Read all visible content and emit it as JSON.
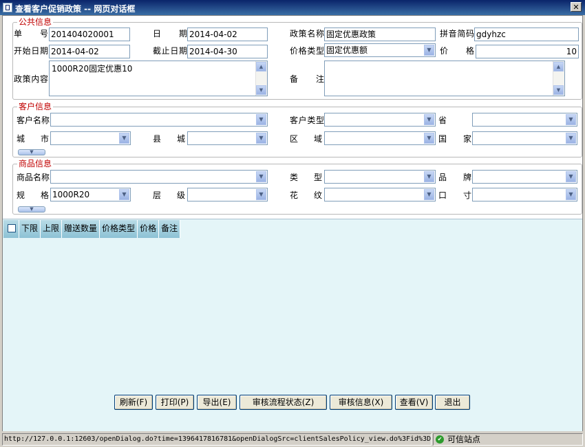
{
  "window": {
    "title": "查看客户促销政策 -- 网页对话框",
    "close": "✕"
  },
  "public": {
    "legend": "公共信息",
    "order_no": {
      "label": "单号",
      "value": "201404020001"
    },
    "date": {
      "label": "日期",
      "value": "2014-04-02"
    },
    "policy_name": {
      "label": "政策名称",
      "value": "固定优惠政策"
    },
    "pinyin": {
      "label": "拼音简码",
      "value": "gdyhzc"
    },
    "start_date": {
      "label": "开始日期",
      "value": "2014-04-02"
    },
    "end_date": {
      "label": "截止日期",
      "value": "2014-04-30"
    },
    "price_type": {
      "label": "价格类型",
      "value": "固定优惠额"
    },
    "price": {
      "label": "价格",
      "value": "10"
    },
    "content": {
      "label": "政策内容",
      "value": "1000R20固定优惠10"
    },
    "remark": {
      "label": "备注",
      "value": ""
    }
  },
  "customer": {
    "legend": "客户信息",
    "name": {
      "label": "客户名称"
    },
    "type": {
      "label": "客户类型"
    },
    "province": {
      "label": "省"
    },
    "city": {
      "label": "城市"
    },
    "county": {
      "label": "县城"
    },
    "district": {
      "label": "区域"
    },
    "country": {
      "label": "国家"
    }
  },
  "product": {
    "legend": "商品信息",
    "name": {
      "label": "商品名称"
    },
    "category": {
      "label": "类型"
    },
    "brand": {
      "label": "品牌"
    },
    "spec": {
      "label": "规格",
      "value": "1000R20"
    },
    "level": {
      "label": "层级"
    },
    "pattern": {
      "label": "花纹"
    },
    "caliber": {
      "label": "口寸"
    }
  },
  "grid": {
    "columns": [
      "下限",
      "上限",
      "赠送数量",
      "价格类型",
      "价格",
      "备注"
    ]
  },
  "buttons": {
    "refresh": "刷新(F)",
    "print": "打印(P)",
    "export": "导出(E)",
    "flow_status": "审核流程状态(Z)",
    "audit_info": "审核信息(X)",
    "view": "查看(V)",
    "exit": "退出"
  },
  "status": {
    "url": "http://127.0.0.1:12603/openDialog.do?time=1396417816781&openDialogSrc=clientSalesPolicy_view.do%3Fid%3D2",
    "trusted": "可信站点"
  },
  "colors": {
    "title_bar": "#0a246a",
    "legend": "#c00000",
    "grid_bg": "#e4f5f8",
    "grid_header": "#a9d1de"
  }
}
